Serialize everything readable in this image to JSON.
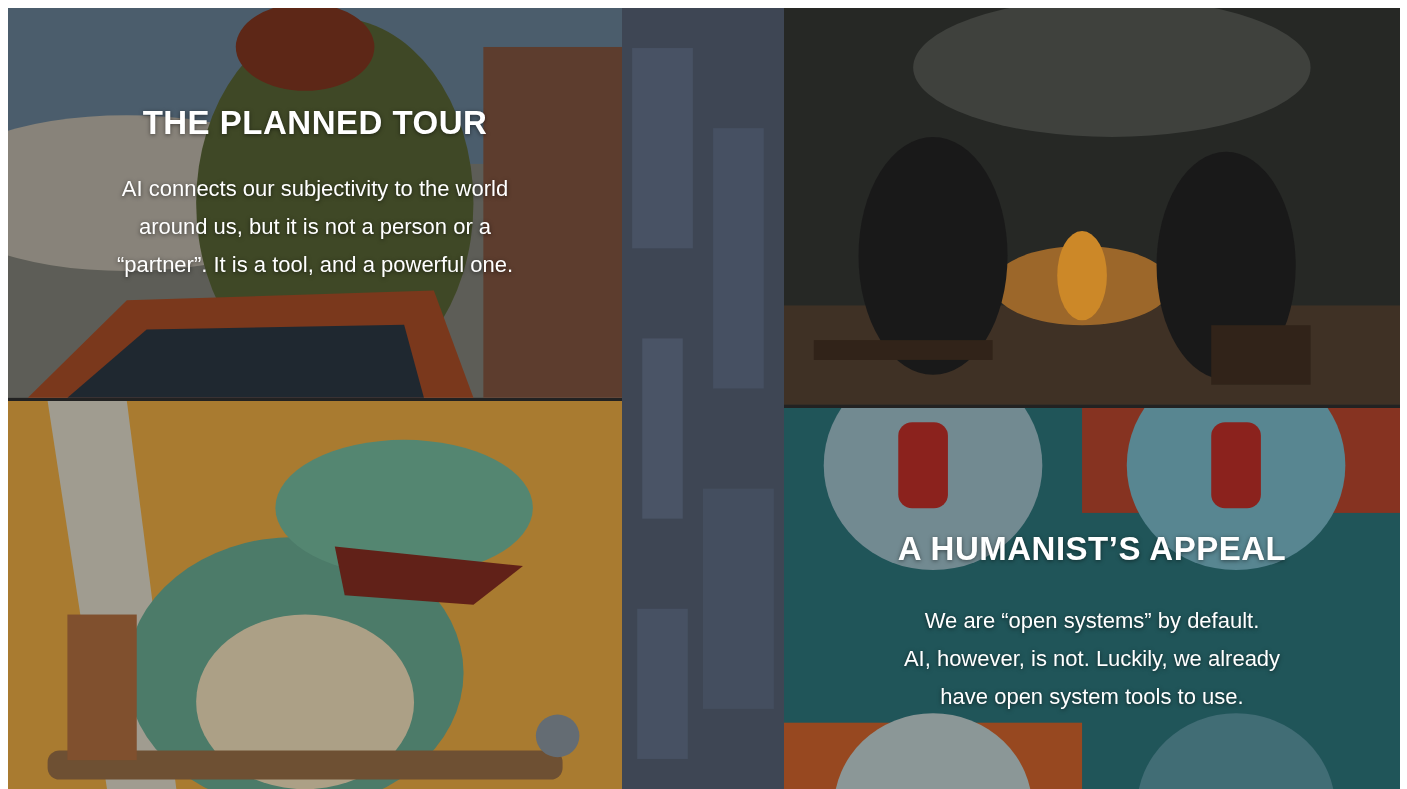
{
  "columns": [
    {
      "kind": "stack",
      "tiles": [
        {
          "kind": "picture",
          "title": "THE PLANNED TOUR",
          "body_lines": [
            "AI connects our subjectivity to the world",
            "around us, but it is not a person or a",
            "“partner”. It is a tool, and a powerful one."
          ]
        },
        {
          "kind": "picture"
        }
      ]
    },
    {
      "kind": "strip"
    },
    {
      "kind": "stack",
      "tiles": [
        {
          "kind": "picture"
        },
        {
          "kind": "picture",
          "title": "A HUMANIST’S APPEAL",
          "body_lines": [
            "We are “open systems” by default.",
            "AI, however, is not. Luckily, we already",
            "have open system tools to use."
          ]
        }
      ]
    }
  ]
}
